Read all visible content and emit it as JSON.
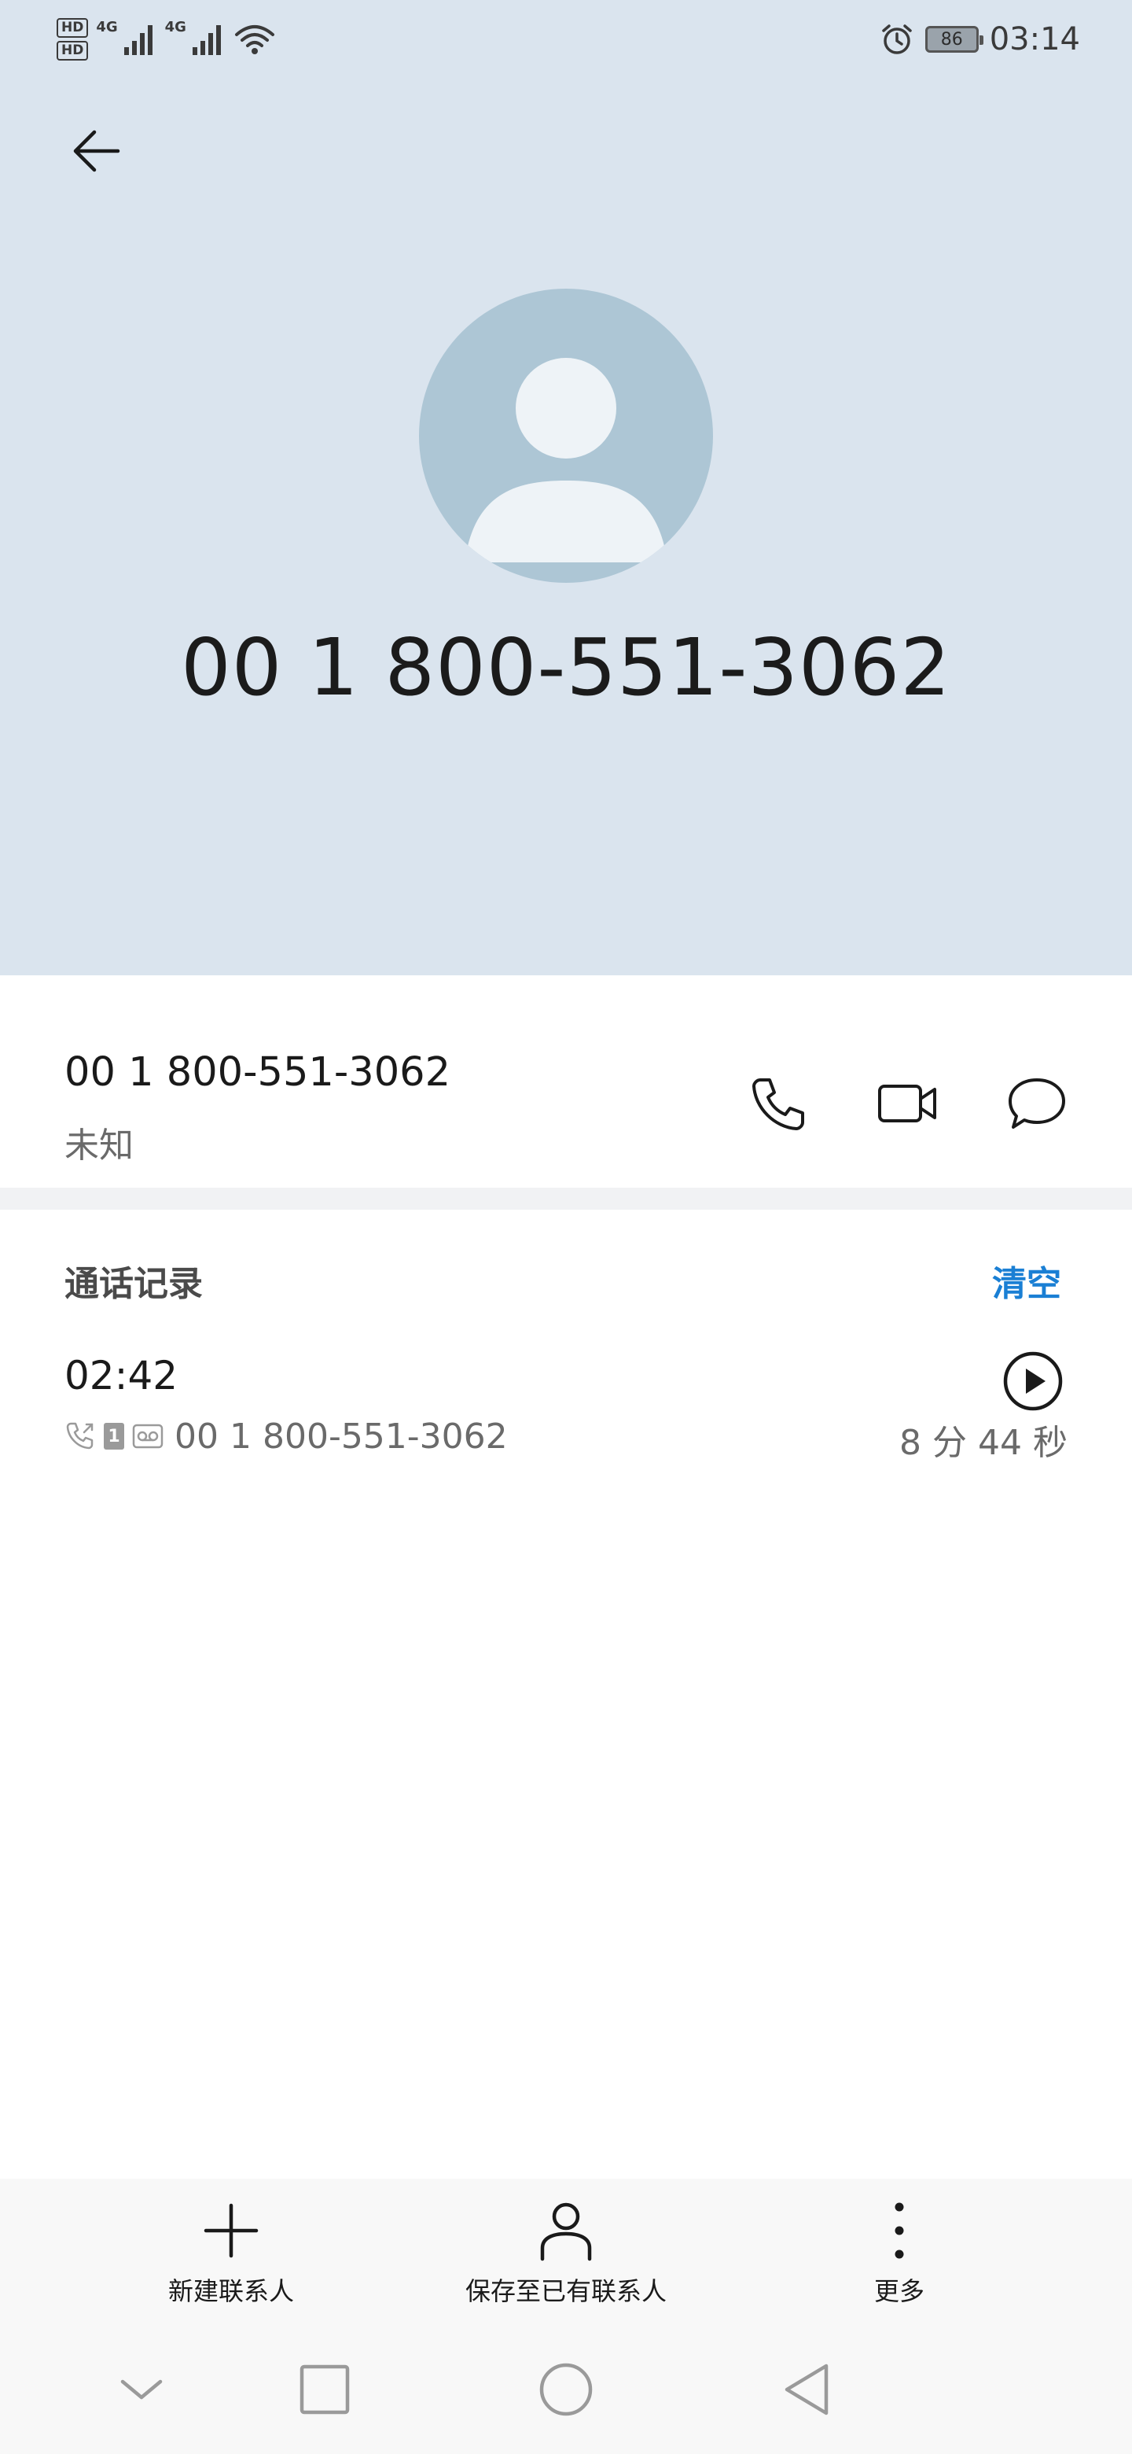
{
  "status_bar": {
    "hd1": "HD",
    "hd2": "HD",
    "network1": "4G",
    "network2": "4G",
    "battery": "86",
    "time": "03:14"
  },
  "contact": {
    "header_number": "00 1 800-551-3062",
    "number": "00 1 800-551-3062",
    "location": "未知"
  },
  "call_log": {
    "title": "通话记录",
    "clear_label": "清空",
    "entries": [
      {
        "time": "02:42",
        "sim": "1",
        "number": "00 1 800-551-3062",
        "duration": "8 分 44 秒"
      }
    ]
  },
  "bottom_actions": {
    "new_contact": "新建联系人",
    "save_existing": "保存至已有联系人",
    "more": "更多"
  },
  "icons": {
    "back": "arrow-left-icon",
    "call": "phone-icon",
    "video": "video-camera-icon",
    "message": "chat-bubble-icon",
    "play": "play-icon"
  },
  "colors": {
    "header_bg": "#dae4ee",
    "avatar_bg": "#adc6d5",
    "accent": "#1a7fd4"
  }
}
